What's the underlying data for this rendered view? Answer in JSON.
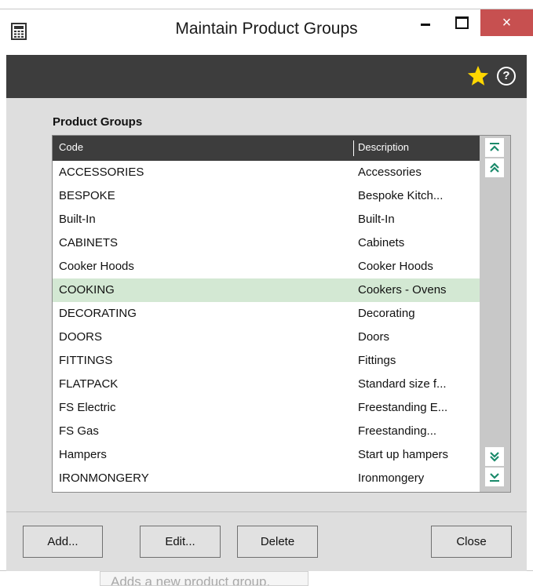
{
  "window": {
    "title": "Maintain Product Groups",
    "close_glyph": "×"
  },
  "toolbar": {
    "icons": [
      "star-icon",
      "help-icon"
    ],
    "help_glyph": "?",
    "star_color": "#ffd700"
  },
  "group_label": "Product Groups",
  "grid": {
    "columns": [
      "Code",
      "Description"
    ],
    "rows": [
      [
        "ACCESSORIES",
        "Accessories"
      ],
      [
        "BESPOKE",
        "Bespoke Kitch..."
      ],
      [
        "Built-In",
        "Built-In"
      ],
      [
        "CABINETS",
        "Cabinets"
      ],
      [
        "Cooker Hoods",
        "Cooker Hoods"
      ],
      [
        "COOKING",
        "Cookers - Ovens"
      ],
      [
        "DECORATING",
        "Decorating"
      ],
      [
        "DOORS",
        "Doors"
      ],
      [
        "FITTINGS",
        "Fittings"
      ],
      [
        "FLATPACK",
        "Standard size f..."
      ],
      [
        "FS Electric",
        "Freestanding E..."
      ],
      [
        "FS Gas",
        "Freestanding..."
      ],
      [
        "Hampers",
        "Start up hampers"
      ],
      [
        "IRONMONGERY",
        "Ironmongery"
      ]
    ],
    "selected_row": 5,
    "selected_color": "#d3e8d3"
  },
  "buttons": {
    "add": "Add...",
    "edit": "Edit...",
    "delete": "Delete",
    "close": "Close"
  },
  "tooltip": "Adds a new product group."
}
